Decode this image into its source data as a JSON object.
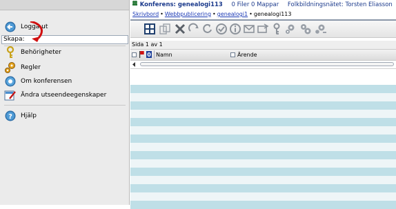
{
  "sidebar": {
    "items": [
      {
        "label": "Logga ut",
        "icon": "back-arrow-icon"
      },
      {
        "label": "Behörigheter",
        "icon": "keys-icon"
      },
      {
        "label": "Regler",
        "icon": "gears-icon"
      },
      {
        "label": "Om konferensen",
        "icon": "info-globe-icon"
      },
      {
        "label": "Ändra utseendeegenskaper",
        "icon": "edit-appearance-icon"
      },
      {
        "label": "Hjälp",
        "icon": "help-icon"
      }
    ],
    "create_label": "Skapa:"
  },
  "header": {
    "conference": "Konferens: genealogi113",
    "counts": "0 Filer 0 Mappar",
    "user": "Folkbildningsnätet: Torsten Eliasson"
  },
  "breadcrumb": [
    "Skrivbord",
    "Webbpublicering",
    "genealogi1",
    "genealogi113"
  ],
  "toolbar": {
    "icons": [
      "grid-view-icon",
      "copy-icon",
      "delete-icon",
      "move-icon",
      "refresh-icon",
      "check-icon",
      "info-icon",
      "mail-icon",
      "send-icon",
      "key-icon",
      "gear-icon",
      "gears-icon",
      "gear-settings-icon"
    ]
  },
  "list": {
    "pager": "Sida 1 av 1",
    "columns": [
      "Namn",
      "Ärende"
    ],
    "row_count": 15
  },
  "colors": {
    "row_tint": "#bfdfe7",
    "row_light": "#eef5f7",
    "title_blue": "#1b3a8c",
    "link_blue": "#1a39b5"
  }
}
